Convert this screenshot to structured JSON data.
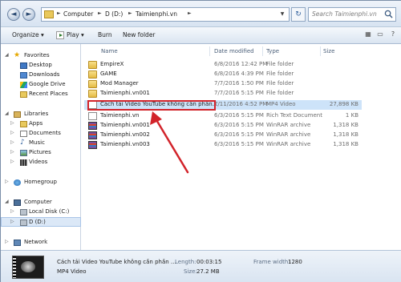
{
  "address": {
    "crumbs": [
      "Computer",
      "D (D:)",
      "Taimienphi.vn"
    ],
    "search_placeholder": "Search Taimienphi.vn",
    "back_glyph": "◄",
    "forward_glyph": "►",
    "refresh_glyph": "↻"
  },
  "toolbar": {
    "organize": "Organize ▾",
    "play": "Play ▾",
    "burn": "Burn",
    "new_folder": "New folder"
  },
  "nav": {
    "favorites": "Favorites",
    "desktop": "Desktop",
    "downloads": "Downloads",
    "google_drive": "Google Drive",
    "recent_places": "Recent Places",
    "libraries": "Libraries",
    "apps": "Apps",
    "documents": "Documents",
    "music": "Music",
    "pictures": "Pictures",
    "videos": "Videos",
    "homegroup": "Homegroup",
    "computer": "Computer",
    "local_disk": "Local Disk (C:)",
    "d_drive": "D (D:)",
    "network": "Network"
  },
  "columns": {
    "name": "Name",
    "date_modified": "Date modified",
    "type": "Type",
    "size": "Size"
  },
  "files": [
    {
      "name": "EmpireX",
      "date": "6/8/2016 12:42 PM",
      "type": "File folder",
      "size": ""
    },
    {
      "name": "GAME",
      "date": "6/8/2016 4:39 PM",
      "type": "File folder",
      "size": ""
    },
    {
      "name": "Mod Manager",
      "date": "7/7/2016 1:50 PM",
      "type": "File folder",
      "size": ""
    },
    {
      "name": "Taimienphi.vn001",
      "date": "7/7/2016 5:15 PM",
      "type": "File folder",
      "size": ""
    },
    {
      "name": "Cách tải Video YouTube không cần phần...",
      "date": "7/11/2016 4:52 PM",
      "type": "MP4 Video",
      "size": "27,898 KB"
    },
    {
      "name": "Taimienphi.vn",
      "date": "6/3/2016 5:15 PM",
      "type": "Rich Text Document",
      "size": "1 KB"
    },
    {
      "name": "Taimienphi.vn001",
      "date": "6/3/2016 5:15 PM",
      "type": "WinRAR archive",
      "size": "1,318 KB"
    },
    {
      "name": "Taimienphi.vn002",
      "date": "6/3/2016 5:15 PM",
      "type": "WinRAR archive",
      "size": "1,318 KB"
    },
    {
      "name": "Taimienphi.vn003",
      "date": "6/3/2016 5:15 PM",
      "type": "WinRAR archive",
      "size": "1,318 KB"
    }
  ],
  "details": {
    "name": "Cách tải Video YouTube không cần phần ...",
    "type": "MP4 Video",
    "length_label": "Length:",
    "length": "00:03:15",
    "size_label": "Size:",
    "size": "27.2 MB",
    "frame_width_label": "Frame width:",
    "frame_width": "1280"
  },
  "colors": {
    "highlight": "#d2232a",
    "selection": "#cde3f9"
  }
}
